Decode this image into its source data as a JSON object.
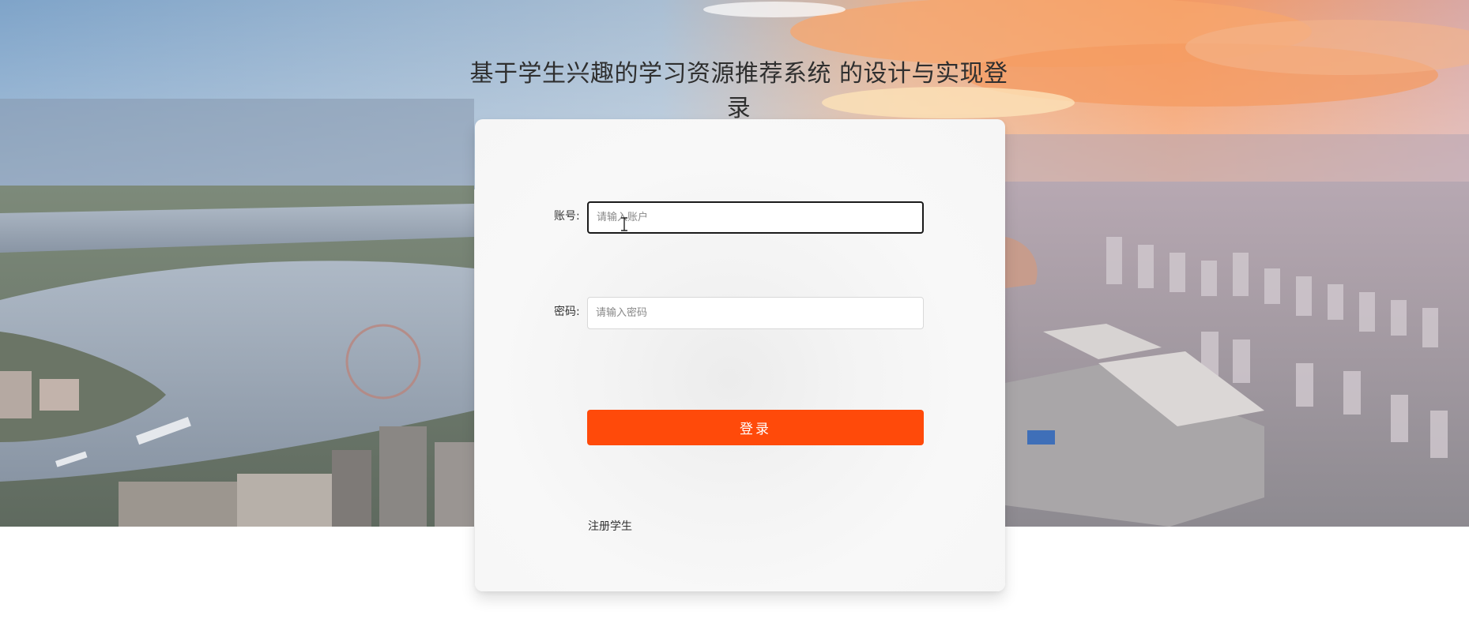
{
  "page": {
    "title": "基于学生兴趣的学习资源推荐系统 的设计与实现登录"
  },
  "login_form": {
    "account_label": "账号:",
    "account_placeholder": "请输入账户",
    "account_value": "",
    "password_label": "密码:",
    "password_placeholder": "请输入密码",
    "password_value": "",
    "login_button": "登录",
    "register_link": "注册学生"
  },
  "background": {
    "description_icon": "city-skyline-sunset-background"
  },
  "colors": {
    "primary_button": "#ff4a0a",
    "title_text": "#2f2f2f",
    "focused_border": "#1a1a1a"
  }
}
